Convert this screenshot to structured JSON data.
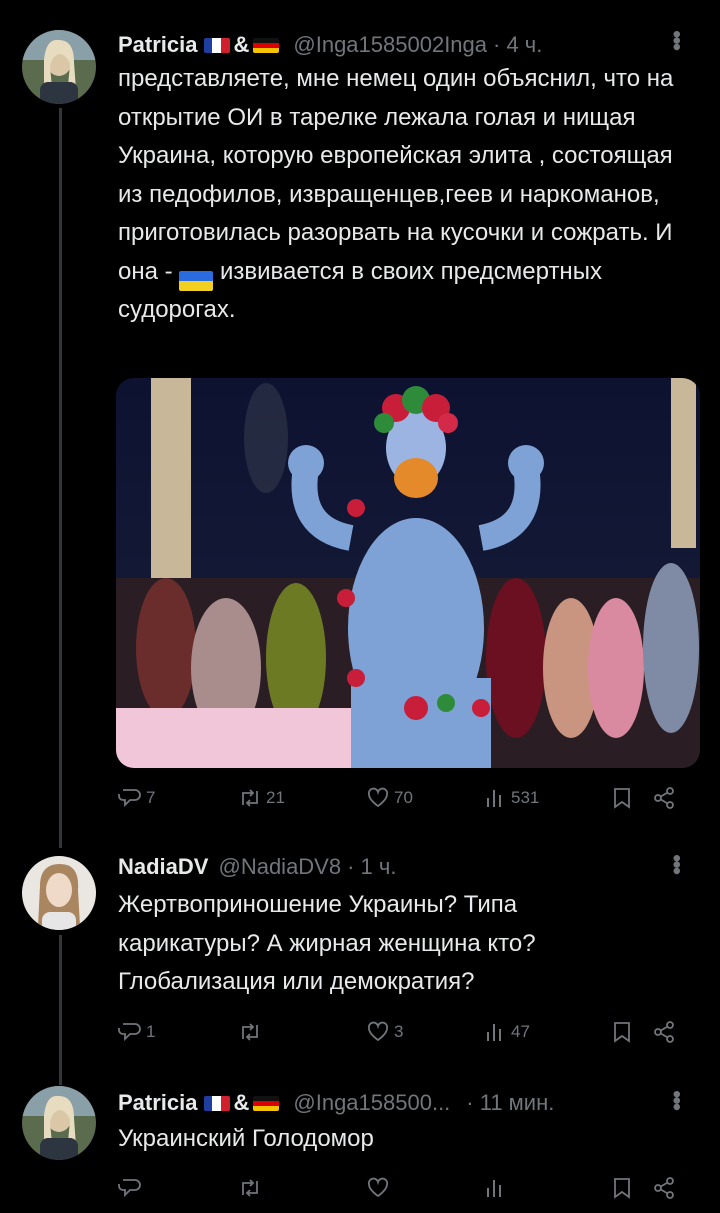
{
  "tweets": [
    {
      "name": "Patricia",
      "handle": "@Inga1585002Inga",
      "time": "· 4 ч.",
      "text_before": "представляете, мне немец один объяснил, что на открытие ОИ в тарелке лежала голая и нищая Украина, которую европейская элита , состоящая из педофилов, извращенцев,геев и наркоманов, приготовилась разорвать на кусочки и сожрать. И она -",
      "text_after": "извивается в своих предсмертных судорогах.",
      "replies": "7",
      "retweets": "21",
      "likes": "70",
      "views": "531"
    },
    {
      "name": "NadiaDV",
      "handle": "@NadiaDV8",
      "time": "· 1 ч.",
      "text": "Жертвоприношение Украины? Типа карикатуры? А жирная женщина кто? Глобализация или демократия?",
      "replies": "1",
      "retweets": "",
      "likes": "3",
      "views": "47"
    },
    {
      "name": "Patricia",
      "handle": "@Inga158500...",
      "time": "· 11 мин.",
      "text": "Украинский Голодомор",
      "replies": "",
      "retweets": "",
      "likes": "",
      "views": ""
    }
  ],
  "colors": {
    "background": "#000000",
    "text": "#e7e9ea",
    "muted": "#71767b"
  },
  "icons": [
    "more-icon",
    "reply-icon",
    "retweet-icon",
    "like-icon",
    "views-icon",
    "bookmark-icon",
    "share-icon",
    "france-flag",
    "germany-flag",
    "ukraine-flag"
  ]
}
